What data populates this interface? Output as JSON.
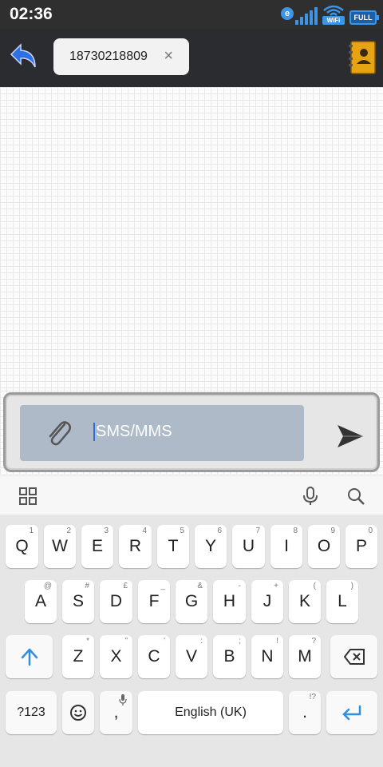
{
  "status_bar": {
    "time": "02:36",
    "network_icon": "e-signal-icon",
    "wifi_label": "WiFi",
    "battery_label": "FULL"
  },
  "header": {
    "back_icon": "back-arrow-icon",
    "recipient": "18730218809",
    "recipient_remove": "×",
    "contacts_icon": "address-book-icon"
  },
  "compose": {
    "attach_icon": "paperclip-icon",
    "placeholder": "SMS/MMS",
    "send_icon": "send-icon"
  },
  "keyboard_toolbar": {
    "left_icon": "grid-icon",
    "mic_icon": "microphone-icon",
    "search_icon": "search-icon"
  },
  "keyboard": {
    "row1": [
      {
        "key": "Q",
        "hint": "1"
      },
      {
        "key": "W",
        "hint": "2"
      },
      {
        "key": "E",
        "hint": "3"
      },
      {
        "key": "R",
        "hint": "4"
      },
      {
        "key": "T",
        "hint": "5"
      },
      {
        "key": "Y",
        "hint": "6"
      },
      {
        "key": "U",
        "hint": "7"
      },
      {
        "key": "I",
        "hint": "8"
      },
      {
        "key": "O",
        "hint": "9"
      },
      {
        "key": "P",
        "hint": "0"
      }
    ],
    "row2": [
      {
        "key": "A",
        "hint": "@"
      },
      {
        "key": "S",
        "hint": "#"
      },
      {
        "key": "D",
        "hint": "£"
      },
      {
        "key": "F",
        "hint": "_"
      },
      {
        "key": "G",
        "hint": "&"
      },
      {
        "key": "H",
        "hint": "-"
      },
      {
        "key": "J",
        "hint": "+"
      },
      {
        "key": "K",
        "hint": "("
      },
      {
        "key": "L",
        "hint": ")"
      }
    ],
    "row3": [
      {
        "key": "Z",
        "hint": "*"
      },
      {
        "key": "X",
        "hint": "\""
      },
      {
        "key": "C",
        "hint": "'"
      },
      {
        "key": "V",
        "hint": ":"
      },
      {
        "key": "B",
        "hint": ";"
      },
      {
        "key": "N",
        "hint": "!"
      },
      {
        "key": "M",
        "hint": "?"
      }
    ],
    "symbols_label": "?123",
    "comma_label": ",",
    "space_label": "English (UK)",
    "period_label": ".",
    "period_hint": "!?",
    "accent_color": "#2f8fe0"
  }
}
